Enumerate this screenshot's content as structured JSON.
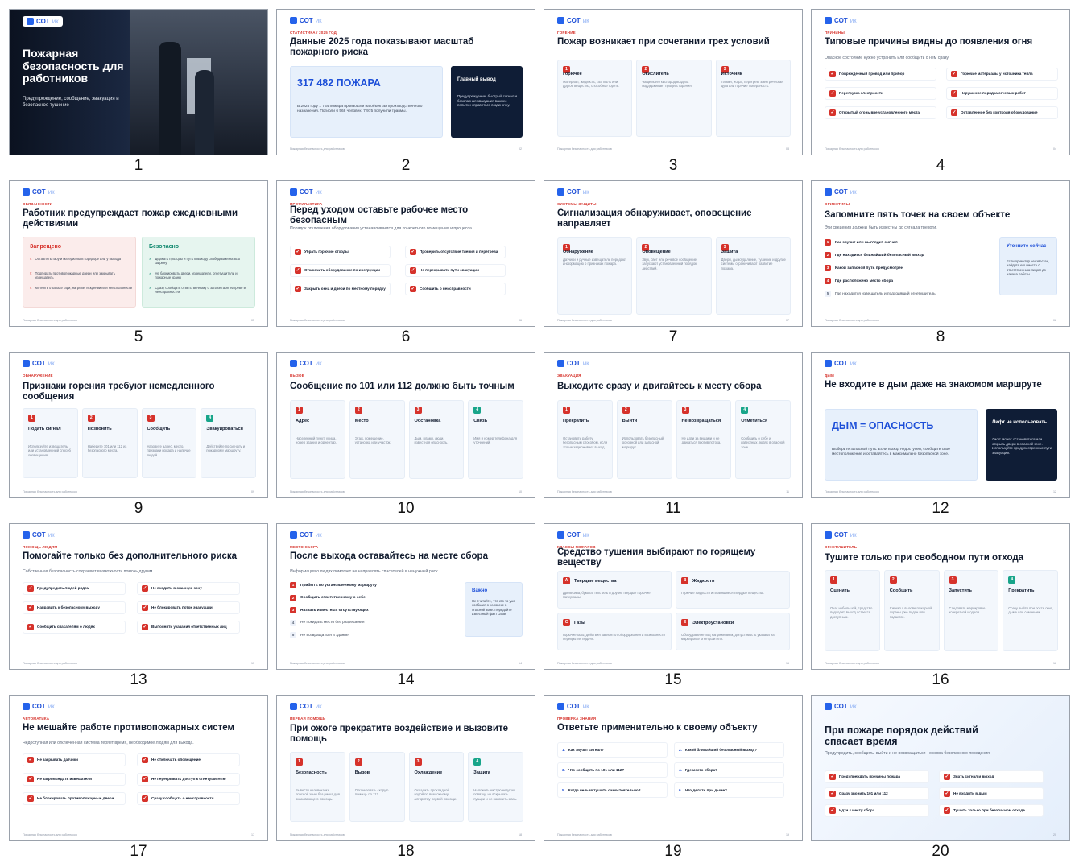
{
  "logo": {
    "main": "СОТ",
    "suffix": "ик"
  },
  "footer": "Пожарная безопасность для работников",
  "slides": [
    {
      "number": "1",
      "title": "Пожарная безопасность для работников",
      "subtitle": "Предупреждение, сообщение, эвакуация и безопасное тушение"
    },
    {
      "number": "2",
      "tag": "СТАТИСТИКА / 2025 ГОД",
      "title": "Данные 2025 года показывают масштаб пожарного риска",
      "big": "317 482 ПОЖАРА",
      "text": "В 2025 году 1 764 пожара произошли на объектах производственного назначения. Погибли 6 568 человек, 7 975 получили травмы.",
      "dark_title": "Главный вывод",
      "dark_text": "Предупреждение, быстрый сигнал и безопасная эвакуация важнее попытки справиться в одиночку.",
      "page": "02"
    },
    {
      "number": "3",
      "tag": "ГОРЕНИЕ",
      "title": "Пожар возникает при сочетании трех условий",
      "cards": [
        {
          "n": "1",
          "h": "Горючее",
          "d": "Материал, жидкость, газ, пыль или другое вещество, способное гореть."
        },
        {
          "n": "2",
          "h": "Окислитель",
          "d": "Чаще всего кислород воздуха поддерживает процесс горения."
        },
        {
          "n": "3",
          "h": "Источник",
          "d": "Пламя, искра, перегрев, электрическая дуга или горячие поверхность."
        }
      ],
      "page": "03"
    },
    {
      "number": "4",
      "tag": "ПРИЧИНЫ",
      "title": "Типовые причины видны до появления огня",
      "subtitle": "Опасное состояние нужно устранить или сообщить о нем сразу.",
      "items": [
        "Поврежденный провод или прибор",
        "Горючие материалы у источника тепла",
        "Перегрузка электросети",
        "Нарушение порядка огневых работ",
        "Открытый огонь вне установленного места",
        "Оставленное без контроля оборудование"
      ],
      "page": "04"
    },
    {
      "number": "5",
      "tag": "ОБЯЗАННОСТИ",
      "title": "Работник предупреждает пожар ежедневными действиями",
      "left_title": "Запрещено",
      "left": [
        "Оставлять тару и материалы в коридоре или у выхода",
        "Подпирать противопожарные двери или закрывать извещатель",
        "Мотнить о запахе гари, нагреве, искрении или неисправности"
      ],
      "right_title": "Безопасно",
      "right": [
        "Держать проходы и путь к выходу свободными на всю ширину",
        "Не блокировать двери, извещатели, огнетушители и пожарные краны",
        "Сразу сообщать ответственному о запахе гари, нагреве и неисправностях"
      ],
      "page": "05"
    },
    {
      "number": "6",
      "tag": "ПРОФИЛАКТИКА",
      "title": "Перед уходом оставьте рабочее место безопасным",
      "subtitle": "Порядок отключения оборудования устанавливается для конкретного помещения и процесса.",
      "items": [
        "Убрать горючие отходы",
        "Проверить отсутствие тления и перегрева",
        "Отключить оборудование по инструкции",
        "Не перекрывать пути эвакуации",
        "Закрыть окна и двери по местному порядку",
        "Сообщить о неисправности"
      ],
      "page": "06"
    },
    {
      "number": "7",
      "tag": "СИСТЕМЫ ЗАЩИТЫ",
      "title": "Сигнализация обнаруживает, оповещение направляет",
      "cards": [
        {
          "n": "1",
          "h": "Обнаружение",
          "d": "Датчики и ручные извещатели передают информацию о признаках пожара."
        },
        {
          "n": "2",
          "h": "Оповещение",
          "d": "Звук, свет или речевое сообщение запускают установленный порядок действий."
        },
        {
          "n": "3",
          "h": "Защита",
          "d": "Двери, дымоудаление, тушение и другие системы ограничивают развитие пожара."
        }
      ],
      "page": "07"
    },
    {
      "number": "8",
      "tag": "ОРИЕНТИРЫ",
      "title": "Запомните пять точек на своем объекте",
      "subtitle": "Эти сведения должны быть известны до сигнала тревоги.",
      "items": [
        "Как звучит или выглядит сигнал",
        "Где находится ближайший безопасный выход",
        "Какой запасной путь предусмотрен",
        "Где расположено место сбора",
        "Где находятся извещатель и подходящий огнетушитель"
      ],
      "side_title": "Уточните сейчас",
      "side_text": "Если ориентир неизвестен, найдите его вместе с ответственным лицом до начала работы.",
      "page": "08"
    },
    {
      "number": "9",
      "tag": "ОБНАРУЖЕНИЕ",
      "title": "Признаки горения требуют немедленного сообщения",
      "cards": [
        {
          "n": "1",
          "h": "Подать сигнал",
          "d": "Используйте извещатель или установленный способ оповещения."
        },
        {
          "n": "2",
          "h": "Позвонить",
          "d": "Наберите 101 или 112 из безопасного места."
        },
        {
          "n": "3",
          "h": "Сообщить",
          "d": "Назовите адрес, место, признаки пожара и наличие людей."
        },
        {
          "n": "4",
          "h": "Эвакуироваться",
          "d": "Действуйте по сигналу и пожарному маршруту."
        }
      ],
      "page": "09"
    },
    {
      "number": "10",
      "tag": "ВЫЗОВ",
      "title": "Сообщение по 101 или 112 должно быть точным",
      "cards": [
        {
          "n": "1",
          "h": "Адрес",
          "d": "Населенный пункт, улица, номер здания и ориентир."
        },
        {
          "n": "2",
          "h": "Место",
          "d": "Этаж, помещение, установка или участок."
        },
        {
          "n": "3",
          "h": "Обстановка",
          "d": "Дым, пламя, люди, известная опасность."
        },
        {
          "n": "4",
          "h": "Связь",
          "d": "Имя и номер телефона для уточнений."
        }
      ],
      "page": "10"
    },
    {
      "number": "11",
      "tag": "ЭВАКУАЦИЯ",
      "title": "Выходите сразу и двигайтесь к месту сбора",
      "cards": [
        {
          "n": "1",
          "h": "Прекратить",
          "d": "Остановить работу безопасным способом, если это не задерживает выход."
        },
        {
          "n": "2",
          "h": "Выйти",
          "d": "Использовать безопасный основной или запасной маршрут."
        },
        {
          "n": "3",
          "h": "Не возвращаться",
          "d": "Не идти за вещами и не двигаться против потока."
        },
        {
          "n": "4",
          "h": "Отметиться",
          "d": "Сообщить о себе и известных людях в опасной зоне."
        }
      ],
      "page": "11"
    },
    {
      "number": "12",
      "tag": "ДЫМ",
      "title": "Не входите в дым даже на знакомом маршруте",
      "big": "ДЫМ = ОПАСНОСТЬ",
      "text": "Выберите запасной путь. Если выход недоступен, сообщите свое местоположение и оставайтесь в максимально безопасной зоне.",
      "dark_title": "Лифт не использовать",
      "dark_text": "Лифт может остановиться или открыть двери в опасной зоне. Используйте предусмотренные пути эвакуации.",
      "page": "12"
    },
    {
      "number": "13",
      "tag": "ПОМОЩЬ ЛЮДЯМ",
      "title": "Помогайте только без дополнительного риска",
      "subtitle": "Собственная безопасность сохраняет возможность помочь другим.",
      "items": [
        "Предупредить людей рядом",
        "Не входить в опасную зону",
        "Направить к безопасному выходу",
        "Не блокировать поток эвакуации",
        "Сообщить спасателям о людях",
        "Выполнять указания ответственных лиц"
      ],
      "page": "13"
    },
    {
      "number": "14",
      "tag": "МЕСТО СБОРА",
      "title": "После выхода оставайтесь на месте сбора",
      "subtitle": "Информация о людях помогает не направлять спасателей в ненужный риск.",
      "items": [
        "Прибыть по установленному маршруту",
        "Сообщить ответственному о себе",
        "Назвать известных отсутствующих",
        "Не покидать место без разрешения",
        "Не возвращаться в здание"
      ],
      "side_title": "Важно",
      "side_text": "Не считайте, что кто-то уже сообщил о человеке в опасной зоне. Передайте известный факт сами.",
      "page": "14"
    },
    {
      "number": "15",
      "tag": "КЛАССЫ ПОЖАРОВ",
      "title": "Средство тушения выбирают по горящему веществу",
      "cards": [
        {
          "n": "A",
          "h": "Твердые вещества",
          "d": "Древесина, бумага, текстиль и другие твердые горючие материалы."
        },
        {
          "n": "B",
          "h": "Жидкости",
          "d": "Горючие жидкости и плавящиеся твердые вещества."
        },
        {
          "n": "C",
          "h": "Газы",
          "d": "Горючие газы; действия зависят от оборудования и возможности перекрытия подачи."
        },
        {
          "n": "E",
          "h": "Электроустановки",
          "d": "Оборудование под напряжением; допустимость указана на маркировке огнетушителя."
        }
      ],
      "page": "15"
    },
    {
      "number": "16",
      "tag": "ОГНЕТУШИТЕЛЬ",
      "title": "Тушите только при свободном пути отхода",
      "cards": [
        {
          "n": "1",
          "h": "Оценить",
          "d": "Очаг небольшой, средство подходит, выход остается доступным."
        },
        {
          "n": "2",
          "h": "Сообщить",
          "d": "Сигнал о вызове пожарной охраны уже подан или подается."
        },
        {
          "n": "3",
          "h": "Запустить",
          "d": "Следовать маркировке конкретной модели."
        },
        {
          "n": "4",
          "h": "Прекратить",
          "d": "Сразу выйти при росте огня, дыме или сомнении."
        }
      ],
      "page": "16"
    },
    {
      "number": "17",
      "tag": "АВТОМАТИКА",
      "title": "Не мешайте работе противопожарных систем",
      "subtitle": "Недоступная или отключенная система теряет время, необходимое людям для выхода.",
      "items": [
        "Не закрывать датчики",
        "Не отключать оповещение",
        "Не загромождать извещатели",
        "Не перекрывать доступ к огнетушителю",
        "Не блокировать противопожарные двери",
        "Сразу сообщать о неисправности"
      ],
      "page": "17"
    },
    {
      "number": "18",
      "tag": "ПЕРВАЯ ПОМОЩЬ",
      "title": "При ожоге прекратите воздействие и вызовите помощь",
      "cards": [
        {
          "n": "1",
          "h": "Безопасность",
          "d": "Вывести человека из опасной зоны без риска для оказывающего помощь."
        },
        {
          "n": "2",
          "h": "Вызов",
          "d": "Организовать скорую помощь по 112."
        },
        {
          "n": "3",
          "h": "Охлаждение",
          "d": "Охладить прохладной водой по возможному алгоритму первой помощи."
        },
        {
          "n": "4",
          "h": "Защита",
          "d": "Наложить чистую нетугую повязку; не вскрывать пузыри и не наносить мазь."
        }
      ],
      "page": "18"
    },
    {
      "number": "19",
      "tag": "ПРОВЕРКА ЗНАНИЯ",
      "title": "Ответьте применительно к своему объекту",
      "items": [
        {
          "n": "1.",
          "t": "Как звучит сигнал?"
        },
        {
          "n": "2.",
          "t": "Какой ближайший безопасный выход?"
        },
        {
          "n": "3.",
          "t": "Что сообщить по 101 или 112?"
        },
        {
          "n": "4.",
          "t": "Где место сбора?"
        },
        {
          "n": "5.",
          "t": "Когда нельзя тушить самостоятельно?"
        },
        {
          "n": "6.",
          "t": "Что делать при дыме?"
        }
      ],
      "page": "19"
    },
    {
      "number": "20",
      "title": "При пожаре порядок действий спасает время",
      "subtitle": "Предупредить, сообщить, выйти и не возвращаться - основа безопасного поведения.",
      "items": [
        "Предупреждать причины пожара",
        "Знать сигнал и выход",
        "Сразу звонить 101 или 112",
        "Не входить в дым",
        "Идти к месту сбора",
        "Тушить только при безопасном отходе"
      ],
      "page": "20"
    }
  ]
}
